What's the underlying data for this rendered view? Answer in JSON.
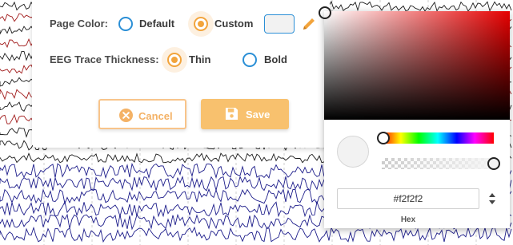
{
  "settings": {
    "page_color_label": "Page Color:",
    "page_color_options": [
      "Default",
      "Custom"
    ],
    "page_color_selected": "Custom",
    "trace_thickness_label": "EEG Trace Thickness:",
    "trace_thickness_options": [
      "Thin",
      "Bold"
    ],
    "trace_thickness_selected": "Thin",
    "current_color": "#f2f2f2",
    "cancel_label": "Cancel",
    "save_label": "Save",
    "icons": {
      "cancel": "close-circle-icon",
      "save": "floppy-disk-icon",
      "edit": "pencil-icon"
    }
  },
  "color_picker": {
    "hue_color": "#e60000",
    "hex_value": "#f2f2f2",
    "hex_label": "Hex"
  },
  "colors": {
    "accent": "#f2a43c",
    "radio_blue": "#2b8fd6",
    "trace_red": "#a01818",
    "trace_black": "#1a1a1a",
    "trace_blue": "#1c1c8a"
  }
}
